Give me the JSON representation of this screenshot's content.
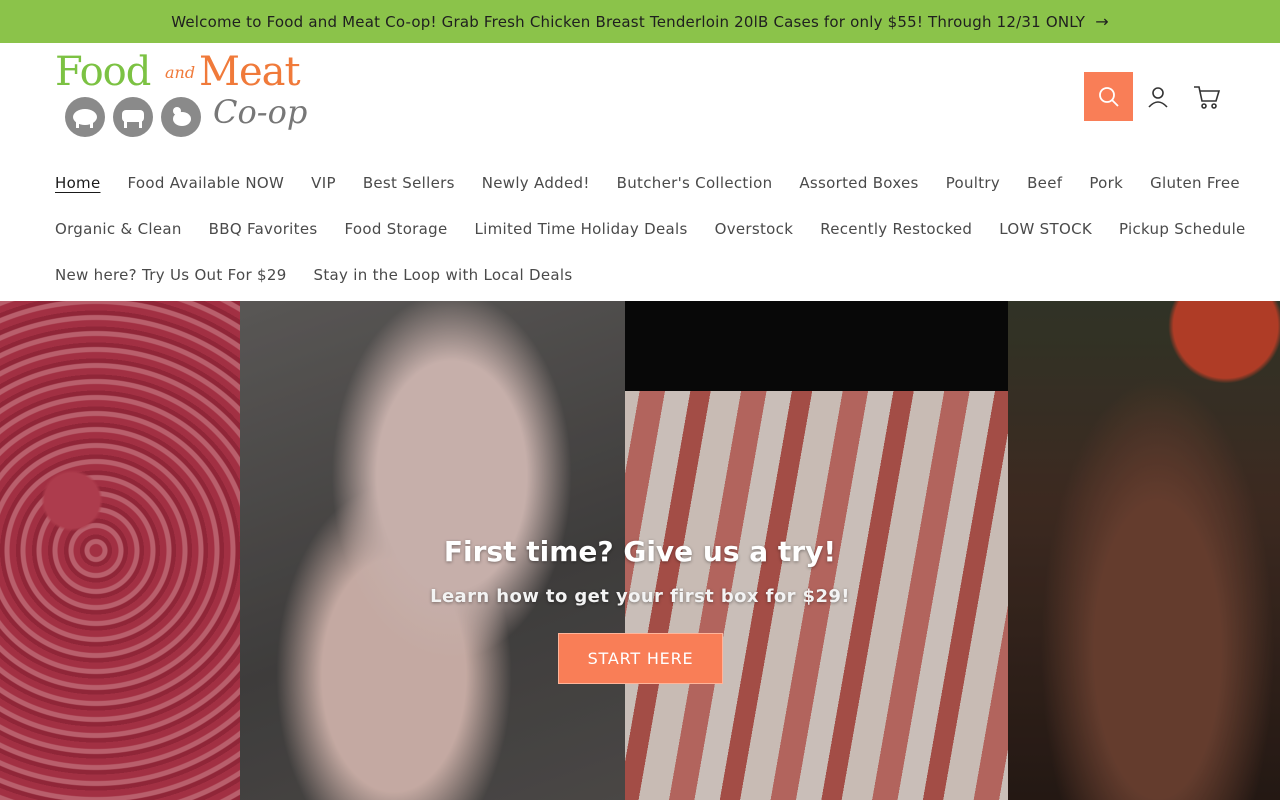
{
  "announcement": {
    "text": "Welcome to Food and Meat Co-op! Grab Fresh Chicken Breast Tenderloin 20lB Cases for only $55! Through 12/31 ONLY",
    "arrow_icon": "arrow-right-icon"
  },
  "logo": {
    "word_food": "Food",
    "word_and": "and",
    "word_meat": "Meat",
    "word_coop": "Co-op",
    "animals": [
      "pig-icon",
      "cow-icon",
      "chicken-icon"
    ]
  },
  "header_icons": [
    "search-icon",
    "account-icon",
    "cart-icon"
  ],
  "nav": {
    "row1": [
      "Home",
      "Food Available NOW",
      "VIP",
      "Best Sellers",
      "Newly Added!",
      "Butcher's Collection",
      "Assorted Boxes",
      "Poultry",
      "Beef",
      "Pork",
      "Gluten Free"
    ],
    "row2": [
      "Organic & Clean",
      "BBQ Favorites",
      "Food Storage",
      "Limited Time Holiday Deals",
      "Overstock",
      "Recently Restocked",
      "LOW STOCK",
      "Pickup Schedule"
    ],
    "row3": [
      "New here? Try Us Out For $29",
      "Stay in the Loop with Local Deals"
    ],
    "active": "Home"
  },
  "hero": {
    "title": "First time? Give us a try!",
    "subtitle": "Learn how to get your first box for $29!",
    "button_label": "START HERE"
  },
  "colors": {
    "announcement_bg": "#8bc34a",
    "accent": "#f97e57",
    "logo_green": "#7cc243",
    "logo_orange": "#f07a3a"
  }
}
